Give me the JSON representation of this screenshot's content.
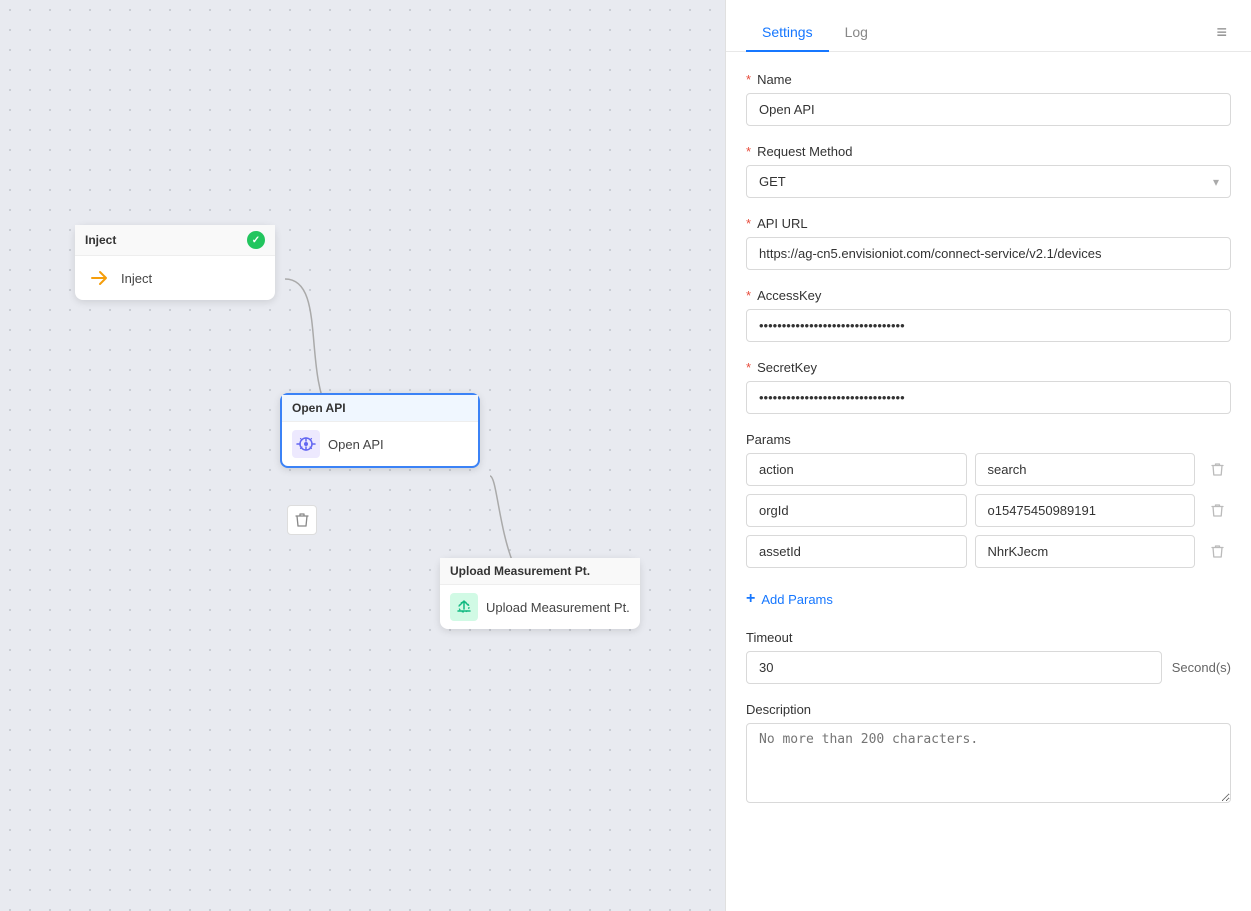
{
  "tabs": [
    {
      "id": "settings",
      "label": "Settings",
      "active": true
    },
    {
      "id": "log",
      "label": "Log",
      "active": false
    }
  ],
  "fields": {
    "name_label": "Name",
    "name_value": "Open API",
    "request_method_label": "Request Method",
    "request_method_value": "GET",
    "api_url_label": "API URL",
    "api_url_value": "https://ag-cn5.envisioniot.com/connect-service/v2.1/devices",
    "access_key_label": "AccessKey",
    "access_key_value": "••••••••••••••••••••••••••••••••",
    "secret_key_label": "SecretKey",
    "secret_key_value": "••••••••••••••••••••••••••••••••",
    "params_label": "Params",
    "params": [
      {
        "key": "action",
        "value": "search"
      },
      {
        "key": "orgId",
        "value": "o15475450989191"
      },
      {
        "key": "assetId",
        "value": "NhrKJecm"
      }
    ],
    "add_params_label": "Add Params",
    "timeout_label": "Timeout",
    "timeout_value": "30",
    "timeout_unit": "Second(s)",
    "description_label": "Description",
    "description_placeholder": "No more than 200 characters."
  },
  "nodes": {
    "inject": {
      "title": "Inject",
      "label": "Inject"
    },
    "openapi": {
      "title": "Open API",
      "label": "Open API"
    },
    "upload": {
      "title": "Upload Measurement Pt.",
      "label": "Upload Measurement Pt."
    }
  },
  "icons": {
    "menu": "≡",
    "check": "✓",
    "arrow_right": "→",
    "plus": "+",
    "trash": "🗑",
    "chevron_down": "▾"
  }
}
